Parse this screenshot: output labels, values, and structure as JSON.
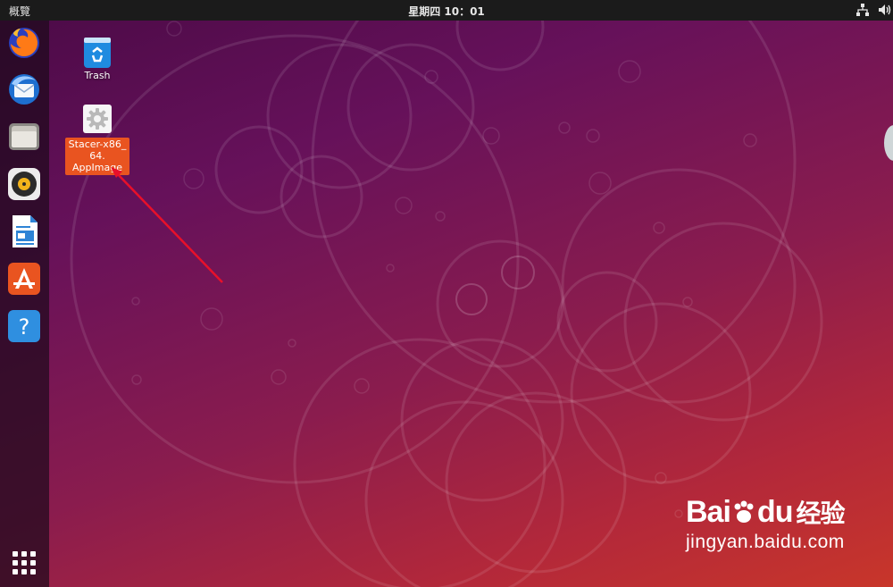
{
  "topbar": {
    "activities_label": "概覽",
    "clock": "星期四 10：01",
    "tray_icons": [
      "network-icon",
      "volume-icon"
    ]
  },
  "dock": {
    "items": [
      {
        "name": "firefox",
        "icon": "firefox-icon"
      },
      {
        "name": "thunderbird",
        "icon": "thunderbird-icon"
      },
      {
        "name": "files",
        "icon": "files-icon"
      },
      {
        "name": "rhythmbox",
        "icon": "rhythmbox-icon"
      },
      {
        "name": "libreoffice-writer",
        "icon": "writer-icon"
      },
      {
        "name": "ubuntu-software",
        "icon": "software-icon"
      },
      {
        "name": "help",
        "icon": "help-icon"
      }
    ],
    "show_apps_icon": "apps-grid-icon"
  },
  "desktop": {
    "trash_label": "Trash",
    "stacer_label_lines": [
      "Stacer-x86_",
      "64.",
      "AppImage"
    ]
  },
  "watermark": {
    "brand_left": "Bai",
    "brand_right": "du",
    "brand_cn": "经验",
    "url": "jingyan.baidu.com"
  },
  "colors": {
    "accent": "#e95420",
    "topbar": "#1b1b1b",
    "arrow": "#e8102a"
  }
}
